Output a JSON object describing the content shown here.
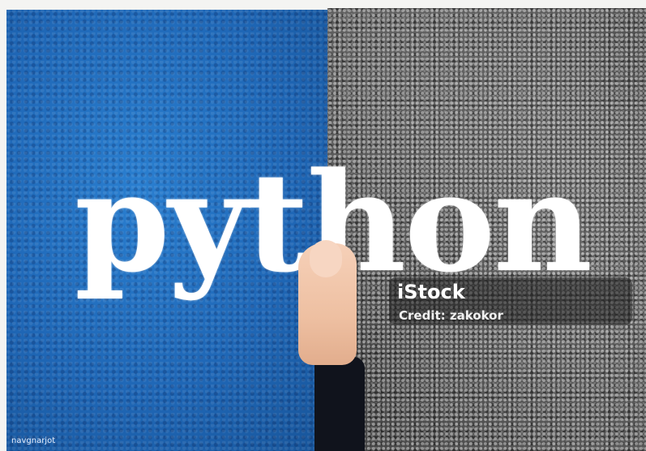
{
  "image": {
    "main_text": "python",
    "watermark": {
      "title": "iStock",
      "credit": "Credit: zakokor"
    },
    "corner_tag": "navgnarjot"
  }
}
